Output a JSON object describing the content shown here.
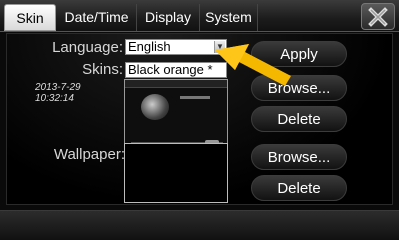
{
  "tabs": [
    {
      "label": "Skin",
      "active": true
    },
    {
      "label": "Date/Time"
    },
    {
      "label": "Display"
    },
    {
      "label": "System"
    }
  ],
  "close_icon": "x-icon",
  "language": {
    "label": "Language:",
    "value": "English"
  },
  "skins": {
    "label": "Skins:",
    "value": "Black orange *"
  },
  "skin_preview": {
    "date": "2013-7-29",
    "time": "10:32:14"
  },
  "wallpaper": {
    "label": "Wallpaper:"
  },
  "buttons": {
    "apply": "Apply",
    "browse_skin": "Browse...",
    "delete_skin": "Delete",
    "browse_wallpaper": "Browse...",
    "delete_wallpaper": "Delete"
  },
  "colors": {
    "pointer": "#f5b800",
    "active_tab": "#ffffff"
  }
}
